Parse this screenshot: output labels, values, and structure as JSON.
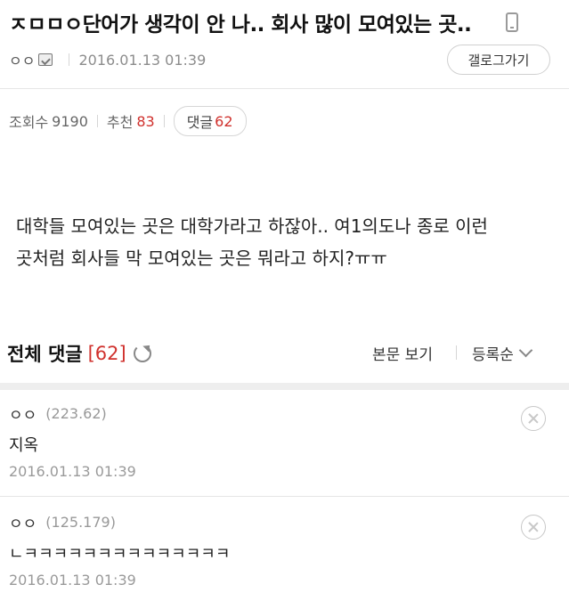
{
  "post": {
    "title": "ㅈㅁㅁㅇ단어가 생각이 안 나.. 회사 많이 모여있는 곳..",
    "author": "ㅇㅇ",
    "date": "2016.01.13 01:39",
    "gallery_button": "갤로그가기",
    "stats": {
      "views_label": "조회수",
      "views": "9190",
      "recommend_label": "추천",
      "recommend": "83",
      "comments_label": "댓글",
      "comments": "62"
    },
    "body_lines": [
      "대학들 모여있는 곳은 대학가라고 하잖아.. 여1의도나 종로 이런",
      "곳처럼 회사들 막 모여있는 곳은 뭐라고 하지?ㅠㅠ"
    ]
  },
  "comments_section": {
    "title": "전체 댓글",
    "count": "[62]",
    "view_body": "본문 보기",
    "sort": "등록순"
  },
  "comments": [
    {
      "author": "ㅇㅇ",
      "ip": "(223.62)",
      "text": "지옥",
      "date": "2016.01.13 01:39"
    },
    {
      "author": "ㅇㅇ",
      "ip": "(125.179)",
      "text": "ㄴㅋㅋㅋㅋㅋㅋㅋㅋㅋㅋㅋㅋㅋㅋ",
      "date": "2016.01.13 01:39"
    }
  ],
  "colors": {
    "accent": "#d0312d",
    "muted": "#8c8c8c",
    "divider": "#eeeeee"
  },
  "icons": [
    "mobile-icon",
    "nickname-icon",
    "refresh-icon",
    "chevron-down-icon",
    "delete-icon"
  ]
}
